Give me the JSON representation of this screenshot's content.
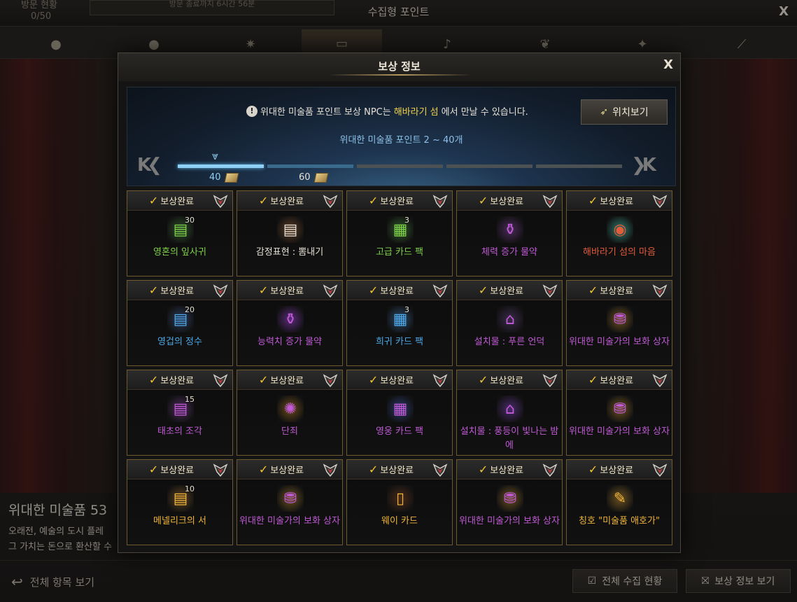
{
  "background": {
    "window_title": "수집형 포인트",
    "counter_label": "방문 현황",
    "counter_value": "0/50",
    "visit_timer": "방문 종료까지 6시간 56분",
    "close": "X",
    "tabs": [
      {
        "icon": "orb-icon"
      },
      {
        "icon": "orb-icon"
      },
      {
        "icon": "star-icon"
      },
      {
        "icon": "painting-icon"
      },
      {
        "icon": "seed-icon"
      },
      {
        "icon": "emblem-icon"
      },
      {
        "icon": "leaf-icon"
      },
      {
        "icon": "telescope-icon"
      }
    ],
    "desc_title": "위대한 미술품 53",
    "desc_line1": "오래전, 예술의 도시 플레",
    "desc_line2": "그 가치는 돈으로 환산할 수",
    "view_all": "전체 항목 보기",
    "btn_collection": "전체 수집 현황",
    "btn_reward": "보상 정보 보기"
  },
  "modal": {
    "title": "보상 정보",
    "close": "X",
    "notice_prefix": "위대한 미술품 포인트 보상 NPC는 ",
    "notice_highlight": "해바라기 섬",
    "notice_suffix": "에서 만날 수 있습니다.",
    "location_button": "위치보기",
    "range_text": "위대한 미술품 포인트 2 ~ 40개",
    "milestones": [
      {
        "value": "40",
        "state": "current"
      },
      {
        "value": "60",
        "state": "next"
      }
    ],
    "progress_fill": 0.2,
    "status_label": "보상완료",
    "colors": {
      "green": "#7fd14a",
      "white": "#e6e1d6",
      "purple": "#c15ad6",
      "blue": "#4ea8e6",
      "orange": "#f0b43a",
      "red": "#e25b3a"
    },
    "rewards": [
      {
        "name": "영혼의 잎사귀",
        "qty": "30",
        "grade": "green",
        "icon": "book-icon",
        "icon_color": "#2e4d2a"
      },
      {
        "name": "감정표현 : 뽐내기",
        "qty": "",
        "grade": "white",
        "icon": "book-icon",
        "icon_color": "#5a3a24"
      },
      {
        "name": "고급 카드 팩",
        "qty": "3",
        "grade": "green",
        "icon": "card-pack-icon",
        "icon_color": "#2f5a2a"
      },
      {
        "name": "체력 증가 물약",
        "qty": "",
        "grade": "purple",
        "icon": "potion-icon",
        "icon_color": "#4a2a5a"
      },
      {
        "name": "해바라기 섬의 마음",
        "qty": "",
        "grade": "red",
        "icon": "globe-icon",
        "icon_color": "#2f7a6a"
      },
      {
        "name": "영겁의 정수",
        "qty": "20",
        "grade": "blue",
        "icon": "book-icon",
        "icon_color": "#2a3a5a"
      },
      {
        "name": "능력치 증가 물약",
        "qty": "",
        "grade": "purple",
        "icon": "potion-icon",
        "icon_color": "#5a2a7a"
      },
      {
        "name": "희귀 카드 팩",
        "qty": "3",
        "grade": "blue",
        "icon": "card-pack-icon",
        "icon_color": "#2a4a6a"
      },
      {
        "name": "설치물 : 푸른 언덕",
        "qty": "",
        "grade": "purple",
        "icon": "easel-icon",
        "icon_color": "#3a2a4a"
      },
      {
        "name": "위대한 미술가의 보화 상자",
        "qty": "",
        "grade": "purple",
        "icon": "chest-icon",
        "icon_color": "#6a5020"
      },
      {
        "name": "태초의 조각",
        "qty": "15",
        "grade": "purple",
        "icon": "book-icon",
        "icon_color": "#4a2a5a"
      },
      {
        "name": "단죄",
        "qty": "",
        "grade": "purple",
        "icon": "rune-icon",
        "icon_color": "#6a4a1a"
      },
      {
        "name": "영웅 카드 팩",
        "qty": "",
        "grade": "purple",
        "icon": "card-pack-icon",
        "icon_color": "#2a3a6a"
      },
      {
        "name": "설치물 : 풍등이 빛나는 밤에",
        "qty": "",
        "grade": "purple",
        "icon": "easel-icon",
        "icon_color": "#4a2a6a"
      },
      {
        "name": "위대한 미술가의 보화 상자",
        "qty": "",
        "grade": "purple",
        "icon": "chest-icon",
        "icon_color": "#6a5020"
      },
      {
        "name": "메넬리크의 서",
        "qty": "10",
        "grade": "orange",
        "icon": "book-icon",
        "icon_color": "#5a4020"
      },
      {
        "name": "위대한 미술가의 보화 상자",
        "qty": "",
        "grade": "purple",
        "icon": "chest-icon",
        "icon_color": "#6a5020"
      },
      {
        "name": "웨이 카드",
        "qty": "",
        "grade": "orange",
        "icon": "card-icon",
        "icon_color": "#4a2a1a"
      },
      {
        "name": "위대한 미술가의 보화 상자",
        "qty": "",
        "grade": "purple",
        "icon": "chest-icon",
        "icon_color": "#6a5020"
      },
      {
        "name": "칭호 \"미술품 애호가\"",
        "qty": "",
        "grade": "orange",
        "icon": "scroll-icon",
        "icon_color": "#6a5020"
      }
    ]
  }
}
